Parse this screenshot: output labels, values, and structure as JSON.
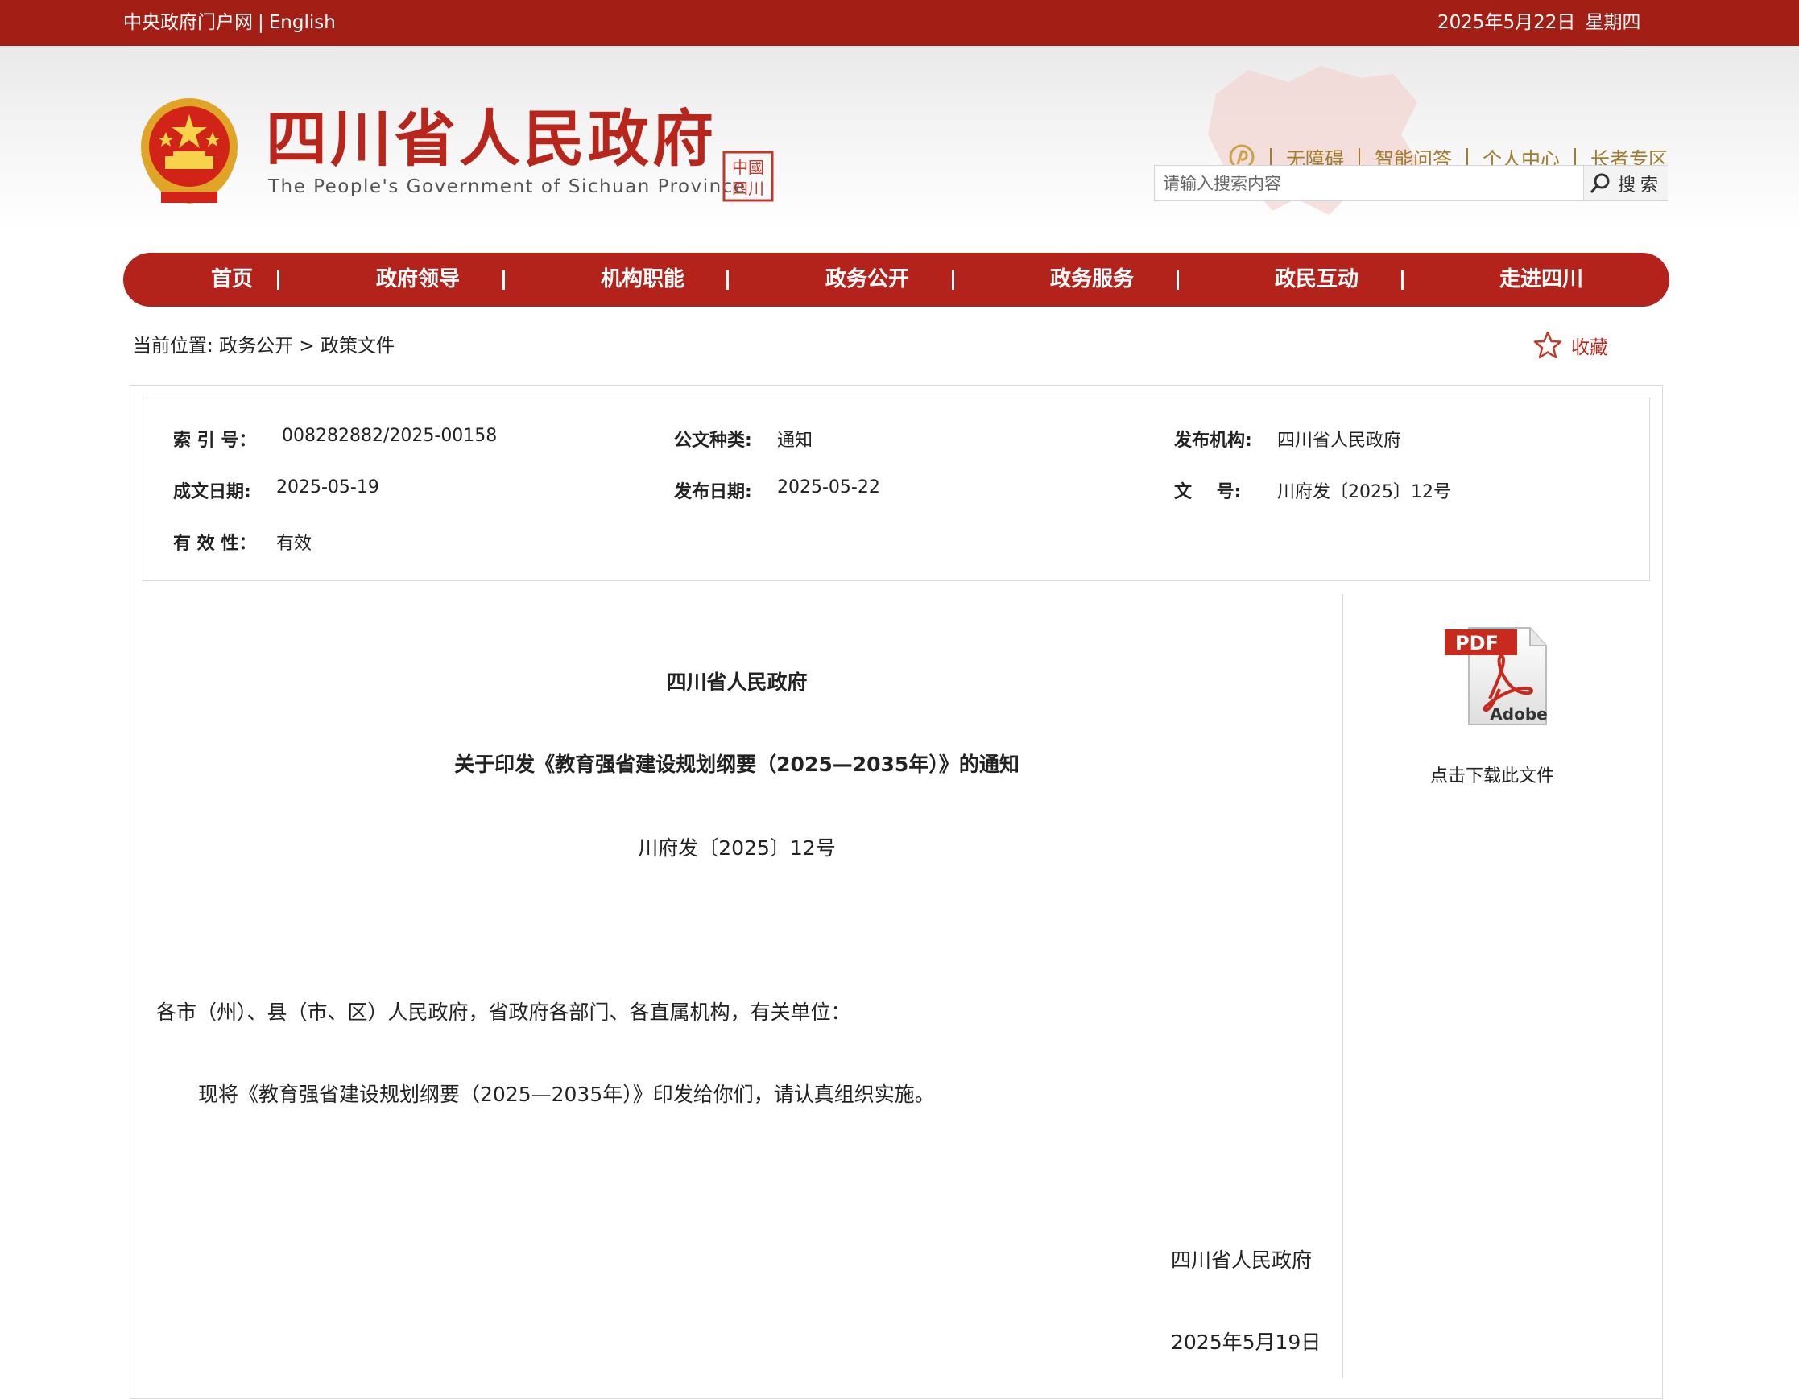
{
  "topbar": {
    "gov_portal": "中央政府门户网",
    "separator": "|",
    "english": "English",
    "date": "2025年5月22日",
    "weekday": "星期四"
  },
  "header": {
    "title": "四川省人民政府",
    "subtitle": "The People's Government of Sichuan Province",
    "seal_text": "中國四川",
    "utility": [
      "无障碍",
      "智能问答",
      "个人中心",
      "长者专区"
    ]
  },
  "search": {
    "placeholder": "请输入搜索内容",
    "button": "搜索"
  },
  "nav": [
    "首页",
    "政府领导",
    "机构职能",
    "政务公开",
    "政务服务",
    "政民互动",
    "走进四川"
  ],
  "breadcrumb": {
    "prefix": "当前位置:",
    "level1": "政务公开",
    "arrow": ">",
    "level2": "政策文件"
  },
  "favorite": "收藏",
  "meta": {
    "index_label": "索 引 号：",
    "index_value": "008282882/2025-00158",
    "type_label": "公文种类:",
    "type_value": "通知",
    "publisher_label": "发布机构:",
    "publisher_value": "四川省人民政府",
    "written_label": "成文日期:",
    "written_value": "2025-05-19",
    "publish_label": "发布日期:",
    "publish_value": "2025-05-22",
    "docno_label": "文    号:",
    "docno_value": "川府发〔2025〕12号",
    "validity_label": "有 效 性：",
    "validity_value": "有效"
  },
  "document": {
    "org": "四川省人民政府",
    "title": "关于印发《教育强省建设规划纲要（2025—2035年）》的通知",
    "number": "川府发〔2025〕12号",
    "salutation": "各市（州）、县（市、区）人民政府，省政府各部门、各直属机构，有关单位：",
    "body": "现将《教育强省建设规划纲要（2025—2035年）》印发给你们，请认真组织实施。",
    "signature": "四川省人民政府",
    "date": "2025年5月19日"
  },
  "download": {
    "pdf_badge": "PDF",
    "brand": "Adobe",
    "caption": "点击下载此文件"
  },
  "colors": {
    "brand_red": "#a31f15",
    "nav_red": "#b3231b",
    "title_red": "#b8261b",
    "utility_gold": "#a07c2c"
  }
}
